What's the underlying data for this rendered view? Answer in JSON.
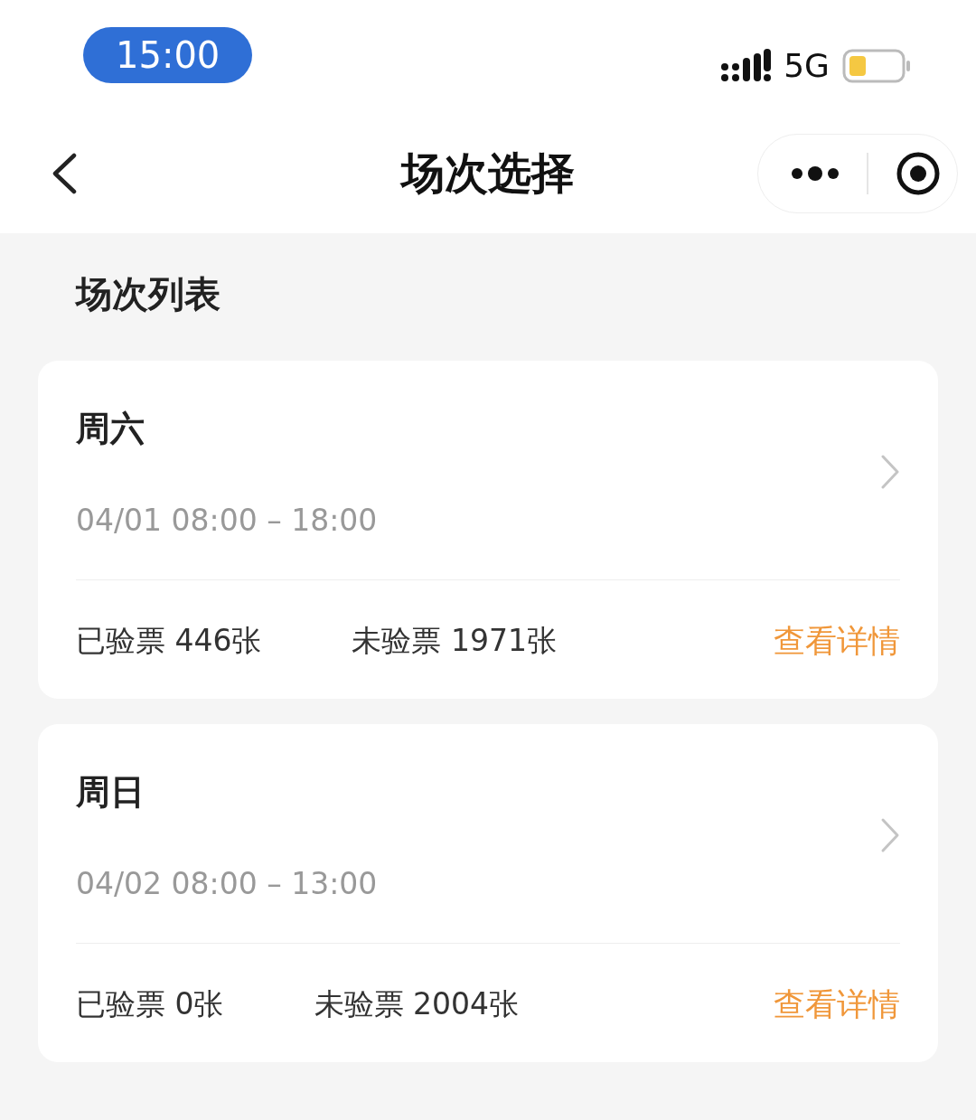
{
  "status_bar": {
    "time": "15:00",
    "network": "5G"
  },
  "nav_bar": {
    "title": "场次选择"
  },
  "section_title": "场次列表",
  "sessions": [
    {
      "day": "周六",
      "time_range": "04/01 08:00 – 18:00",
      "checked": "已验票 446张",
      "unchecked": "未验票 1971张",
      "link": "查看详情"
    },
    {
      "day": "周日",
      "time_range": "04/02 08:00 – 13:00",
      "checked": "已验票 0张",
      "unchecked": "未验票 2004张",
      "link": "查看详情"
    }
  ]
}
